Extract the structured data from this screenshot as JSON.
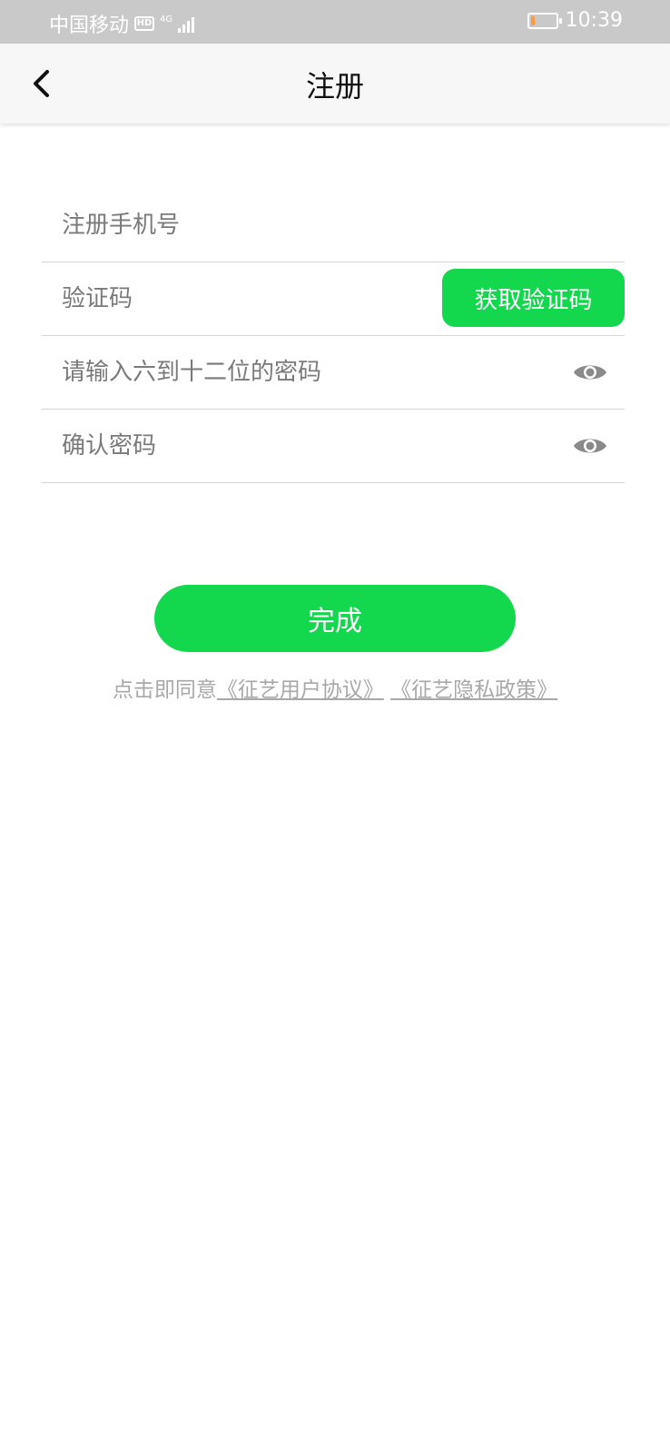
{
  "status_bar": {
    "carrier": "中国移动",
    "hd": "HD",
    "network": "4G",
    "time": "10:39",
    "battery_level": 0.15,
    "battery_color": "#ff9a3c"
  },
  "header": {
    "title": "注册",
    "back_icon": "chevron-left-icon"
  },
  "form": {
    "phone_placeholder": "注册手机号",
    "code_placeholder": "验证码",
    "get_code_label": "获取验证码",
    "password_placeholder": "请输入六到十二位的密码",
    "confirm_placeholder": "确认密码",
    "eye_icon": "eye-icon"
  },
  "submit": {
    "label": "完成"
  },
  "agreement": {
    "prefix": "点击即同意",
    "user_agreement": "《征艺用户协议》",
    "privacy_policy": "《征艺隐私政策》"
  },
  "colors": {
    "accent": "#13d84d",
    "status_bar_bg": "#c9c9c9",
    "header_bg": "#f7f7f7",
    "divider": "#d4d4d4"
  }
}
